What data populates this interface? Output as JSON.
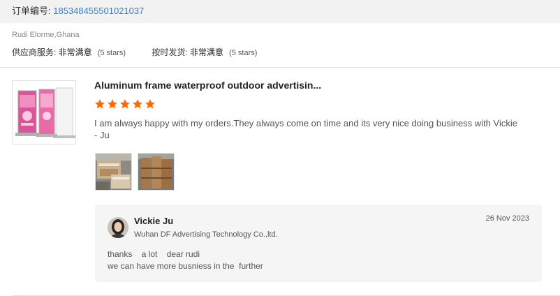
{
  "order": {
    "label": "订单编号: ",
    "number": "185348455501021037"
  },
  "buyer": {
    "name": "Rudi Elorme,Ghana"
  },
  "ratings": [
    {
      "label": "供应商服务: ",
      "value": "非常满意",
      "stars": "(5 stars)"
    },
    {
      "label": "按时发货: ",
      "value": "非常满意",
      "stars": "(5 stars)"
    }
  ],
  "review": {
    "product_title": "Aluminum frame waterproof outdoor advertisin...",
    "rating": 5,
    "star_color": "#ff6a00",
    "text": "I am always happy with my orders.They always come on time and its very nice doing business with Vickie - Ju"
  },
  "reply": {
    "seller_name": "Vickie Ju",
    "company": "Wuhan DF Advertising Technology Co.,ltd.",
    "date": "26 Nov 2023",
    "text": "thanks    a lot    dear rudi\nwe can have more busniess in the  further"
  },
  "colors": {
    "link": "#2f7fd6",
    "star": "#ff6a00",
    "reply_bg": "#f5f5f5"
  },
  "icons": {
    "product": "roll-up-banner-stand-image",
    "photo_1": "packed-boxes-photo",
    "photo_2": "stacked-cartons-photo",
    "avatar": "seller-avatar"
  }
}
